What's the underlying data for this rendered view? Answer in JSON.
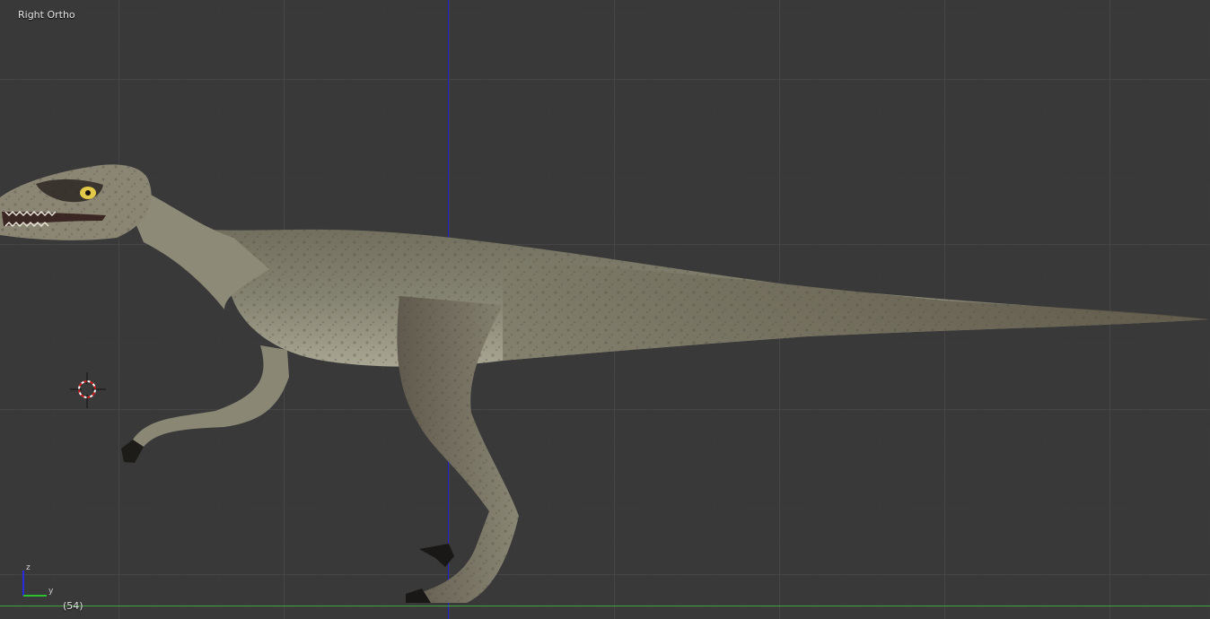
{
  "viewport": {
    "view_label": "Right Ortho",
    "frame_label": "(54)",
    "background_color": "#393939",
    "axis_z_color": "#1b1bd6",
    "axis_y_color": "#3fa53f"
  },
  "gizmo": {
    "z_label": "z",
    "y_label": "y"
  },
  "model": {
    "icon": "raptor-model",
    "skin_color": "#7c7a68",
    "belly_color": "#a6a48f",
    "eye_color": "#e2c94a"
  }
}
